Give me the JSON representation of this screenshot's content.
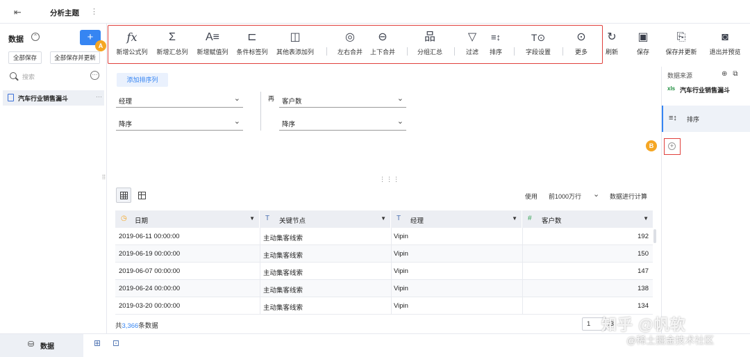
{
  "topbar": {
    "back_icon": "exit-icon",
    "title": "分析主题",
    "more": "⋮"
  },
  "left": {
    "title": "数据",
    "add": "+",
    "badge": "A",
    "save_all": "全部保存",
    "save_update_all": "全部保存并更新",
    "search_placeholder": "搜索",
    "ellipsis": "···",
    "table_item": "汽车行业销售漏斗",
    "item_more": "···"
  },
  "toolbar": {
    "items": [
      {
        "label": "新增公式列",
        "glyph": "fx"
      },
      {
        "label": "新增汇总列",
        "glyph": "Σ"
      },
      {
        "label": "新增赋值列",
        "glyph": "A≡"
      },
      {
        "label": "条件标签列",
        "glyph": "⊏"
      },
      {
        "label": "其他表添加列",
        "glyph": "◫"
      },
      {
        "label": "左右合并",
        "glyph": "◎"
      },
      {
        "label": "上下合并",
        "glyph": "⊖"
      },
      {
        "label": "分组汇总",
        "glyph": "品"
      },
      {
        "label": "过滤",
        "glyph": "▽"
      },
      {
        "label": "排序",
        "glyph": "≡↕"
      },
      {
        "label": "字段设置",
        "glyph": "T⊙"
      },
      {
        "label": "更多",
        "glyph": "⊙"
      }
    ],
    "right_items": [
      {
        "label": "刷新",
        "glyph": "↻"
      },
      {
        "label": "保存",
        "glyph": "▣"
      },
      {
        "label": "保存并更新",
        "glyph": "⎘"
      },
      {
        "label": "退出并预览",
        "glyph": "◙"
      }
    ]
  },
  "right_panel": {
    "source_label": "数据来源",
    "xls_tag": "xls",
    "table_name": "汽车行业销售漏斗",
    "sort_label": "排序",
    "badge": "B",
    "add": "+"
  },
  "sort": {
    "add_label": "添加排序列",
    "then_label": "再",
    "rules": [
      {
        "field": "经理",
        "order": "降序"
      },
      {
        "field": "客户数",
        "order": "降序"
      }
    ]
  },
  "data_view": {
    "use_label": "使用",
    "rows_option": "前1000万行",
    "calc_label": "数据进行计算",
    "columns": [
      {
        "name": "日期",
        "type_icon": "clock-icon",
        "glyph": "◷"
      },
      {
        "name": "关键节点",
        "type_icon": "text-type-icon",
        "glyph": "T"
      },
      {
        "name": "经理",
        "type_icon": "text-type-icon",
        "glyph": "T"
      },
      {
        "name": "客户数",
        "type_icon": "number-type-icon",
        "glyph": "#"
      }
    ],
    "rows": [
      [
        "2019-06-11 00:00:00",
        "主动集客线索",
        "Vipin",
        "192"
      ],
      [
        "2019-06-19 00:00:00",
        "主动集客线索",
        "Vipin",
        "150"
      ],
      [
        "2019-06-07 00:00:00",
        "主动集客线索",
        "Vipin",
        "147"
      ],
      [
        "2019-06-24 00:00:00",
        "主动集客线索",
        "Vipin",
        "138"
      ],
      [
        "2019-03-20 00:00:00",
        "主动集客线索",
        "Vipin",
        "134"
      ]
    ],
    "total_prefix": "共",
    "total_count": "3,366",
    "total_suffix": "条数据",
    "page_value": "1",
    "page_total": "/3"
  },
  "bottombar": {
    "tab_label": "数据"
  },
  "watermark": {
    "line1": "知乎 @帆软",
    "line2": "@稀土掘金技术社区"
  },
  "colors": {
    "accent": "#3685f2",
    "highlight_box": "#e0403c",
    "badge": "#f5a623"
  }
}
